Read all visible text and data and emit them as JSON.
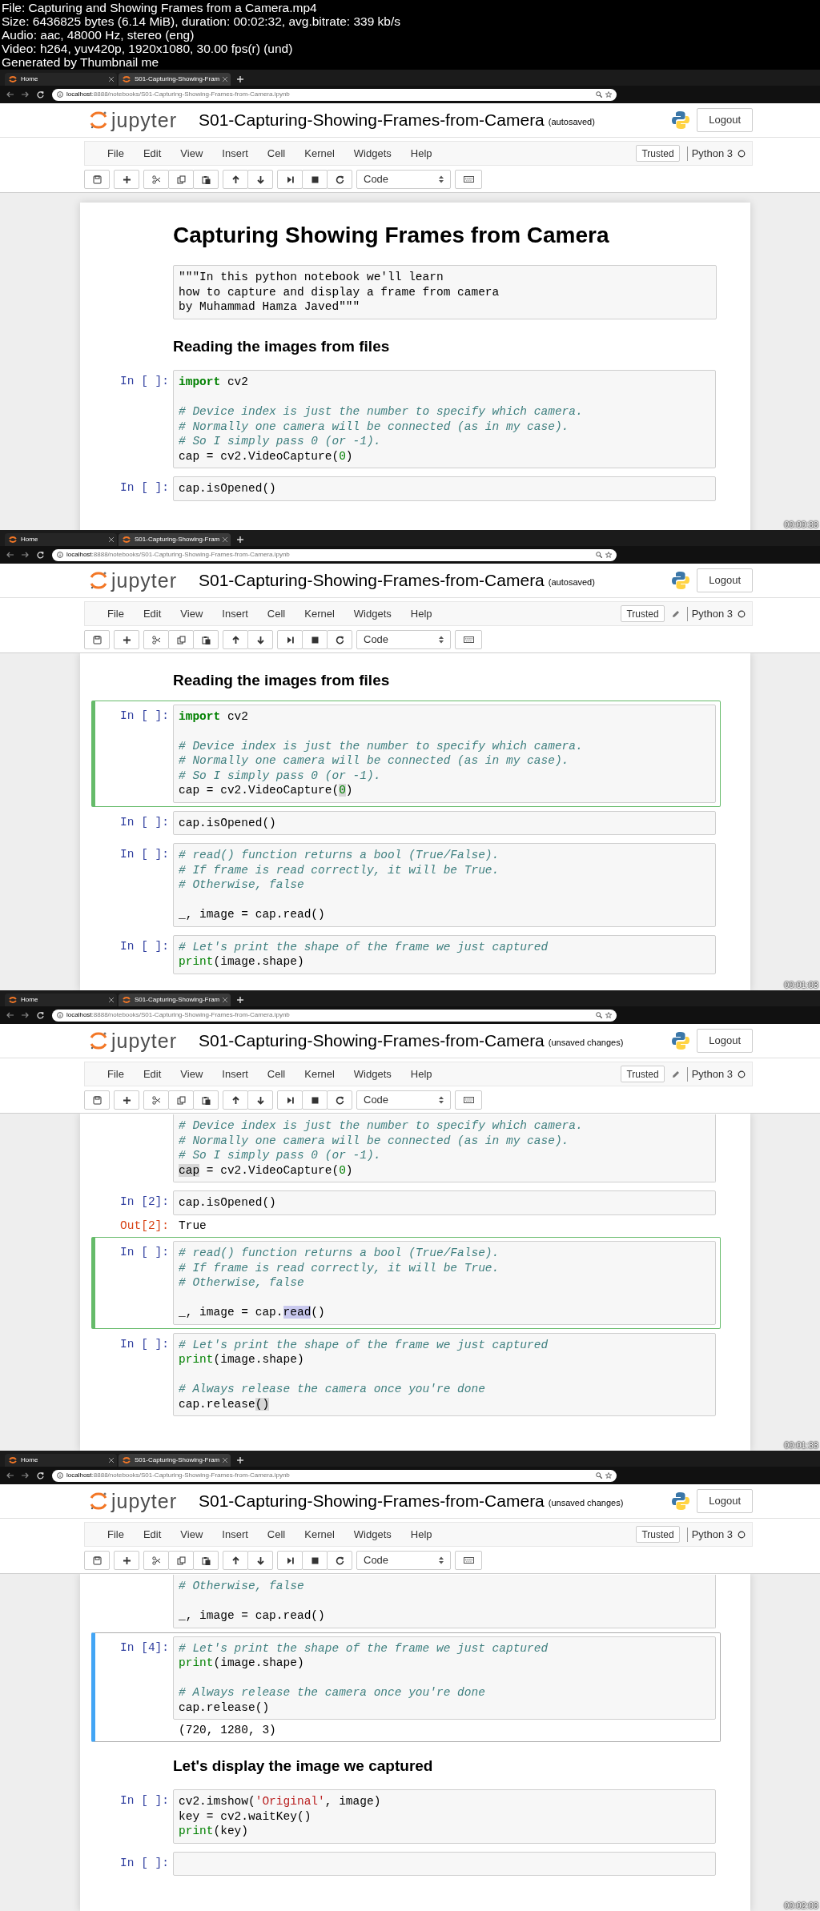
{
  "file_info": [
    "File: Capturing and Showing Frames from a Camera.mp4",
    "Size: 6436825 bytes (6.14 MiB), duration: 00:02:32, avg.bitrate: 339 kb/s",
    "Audio: aac, 48000 Hz, stereo (eng)",
    "Video: h264, yuv420p, 1920x1080, 30.00 fps(r) (und)",
    "Generated by Thumbnail me"
  ],
  "frames": [
    {
      "timestamp": "00:00:33",
      "tabs": [
        {
          "title": "Home",
          "selected": false
        },
        {
          "title": "S01-Capturing-Showing-Fram",
          "selected": true
        }
      ],
      "url_host": "localhost",
      "url_rest": ":8888/notebooks/S01-Capturing-Showing-Frames-from-Camera.ipynb",
      "logo_text": "jupyter",
      "notebook_name": "S01-Capturing-Showing-Frames-from-Camera",
      "save_status": "(autosaved)",
      "logout": "Logout",
      "menu": [
        "File",
        "Edit",
        "View",
        "Insert",
        "Cell",
        "Kernel",
        "Widgets",
        "Help"
      ],
      "trusted": "Trusted",
      "edit_indicator": false,
      "kernel": "Python 3",
      "cell_type": "Code",
      "page_top_visible": true,
      "cells": [
        {
          "kind": "heading1",
          "text": "Capturing Showing Frames from Camera"
        },
        {
          "kind": "raw",
          "lines": [
            "\"\"\"In this python notebook we'll learn",
            "how to capture and display a frame from camera",
            "by Muhammad Hamza Javed\"\"\""
          ]
        },
        {
          "kind": "heading2",
          "text": "Reading the images from files"
        },
        {
          "kind": "code",
          "prompt": "In [ ]:",
          "selected": false,
          "cut_top": false,
          "lines": [
            {
              "kind": "code",
              "tokens": [
                {
                  "kind": "keyword",
                  "text": "import"
                },
                {
                  "kind": "plain",
                  "text": " cv2"
                }
              ]
            },
            {
              "kind": "blank"
            },
            {
              "kind": "code",
              "tokens": [
                {
                  "kind": "comment",
                  "text": "# Device index is just the number to specify which camera."
                }
              ]
            },
            {
              "kind": "code",
              "tokens": [
                {
                  "kind": "comment",
                  "text": "# Normally one camera will be connected (as in my case)."
                }
              ]
            },
            {
              "kind": "code",
              "tokens": [
                {
                  "kind": "comment",
                  "text": "# So I simply pass 0 (or -1)."
                }
              ]
            },
            {
              "kind": "code",
              "tokens": [
                {
                  "kind": "plain",
                  "text": "cap = cv2.VideoCapture("
                },
                {
                  "kind": "number",
                  "text": "0"
                },
                {
                  "kind": "plain",
                  "text": ")"
                }
              ]
            }
          ]
        },
        {
          "kind": "code",
          "prompt": "In [ ]:",
          "selected": false,
          "cut_top": false,
          "lines": [
            {
              "kind": "code",
              "tokens": [
                {
                  "kind": "plain",
                  "text": "cap.isOpened()"
                }
              ]
            }
          ]
        }
      ]
    },
    {
      "timestamp": "00:01:03",
      "tabs": [
        {
          "title": "Home",
          "selected": false
        },
        {
          "title": "S01-Capturing-Showing-Fram",
          "selected": true
        }
      ],
      "url_host": "localhost",
      "url_rest": ":8888/notebooks/S01-Capturing-Showing-Frames-from-Camera.ipynb",
      "logo_text": "jupyter",
      "notebook_name": "S01-Capturing-Showing-Frames-from-Camera",
      "save_status": "(autosaved)",
      "logout": "Logout",
      "menu": [
        "File",
        "Edit",
        "View",
        "Insert",
        "Cell",
        "Kernel",
        "Widgets",
        "Help"
      ],
      "trusted": "Trusted",
      "edit_indicator": true,
      "kernel": "Python 3",
      "cell_type": "Code",
      "page_top_visible": false,
      "cells": [
        {
          "kind": "heading2",
          "text": "Reading the images from files"
        },
        {
          "kind": "code",
          "prompt": "In [ ]:",
          "selected": true,
          "editing": true,
          "cut_top": false,
          "lines": [
            {
              "kind": "code",
              "tokens": [
                {
                  "kind": "keyword",
                  "text": "import"
                },
                {
                  "kind": "plain",
                  "text": " cv2"
                }
              ]
            },
            {
              "kind": "blank"
            },
            {
              "kind": "code",
              "tokens": [
                {
                  "kind": "comment",
                  "text": "# Device index is just the number to specify which camera."
                }
              ]
            },
            {
              "kind": "code",
              "tokens": [
                {
                  "kind": "comment",
                  "text": "# Normally one camera will be connected (as in my case)."
                }
              ]
            },
            {
              "kind": "code",
              "tokens": [
                {
                  "kind": "comment",
                  "text": "# So I simply pass 0 (or -1)."
                }
              ]
            },
            {
              "kind": "code",
              "tokens": [
                {
                  "kind": "plain",
                  "text": "cap = cv2.VideoCapture("
                },
                {
                  "kind": "number_match",
                  "text": "0"
                },
                {
                  "kind": "plain",
                  "text": ")"
                }
              ]
            }
          ]
        },
        {
          "kind": "code",
          "prompt": "In [ ]:",
          "selected": false,
          "cut_top": false,
          "lines": [
            {
              "kind": "code",
              "tokens": [
                {
                  "kind": "plain",
                  "text": "cap.isOpened()"
                }
              ]
            }
          ]
        },
        {
          "kind": "code",
          "prompt": "In [ ]:",
          "selected": false,
          "cut_top": false,
          "lines": [
            {
              "kind": "code",
              "tokens": [
                {
                  "kind": "comment",
                  "text": "# read() function returns a bool (True/False)."
                }
              ]
            },
            {
              "kind": "code",
              "tokens": [
                {
                  "kind": "comment",
                  "text": "# If frame is read correctly, it will be True."
                }
              ]
            },
            {
              "kind": "code",
              "tokens": [
                {
                  "kind": "comment",
                  "text": "# Otherwise, false"
                }
              ]
            },
            {
              "kind": "blank"
            },
            {
              "kind": "code",
              "tokens": [
                {
                  "kind": "plain",
                  "text": "_, image = cap.read()"
                }
              ]
            }
          ]
        },
        {
          "kind": "code",
          "prompt": "In [ ]:",
          "selected": false,
          "cut_top": false,
          "lines": [
            {
              "kind": "code",
              "tokens": [
                {
                  "kind": "comment",
                  "text": "# Let's print the shape of the frame we just captured"
                }
              ]
            },
            {
              "kind": "code",
              "tokens": [
                {
                  "kind": "builtin",
                  "text": "print"
                },
                {
                  "kind": "plain",
                  "text": "(image.shape)"
                }
              ]
            }
          ]
        }
      ]
    },
    {
      "timestamp": "00:01:33",
      "tabs": [
        {
          "title": "Home",
          "selected": false
        },
        {
          "title": "S01-Capturing-Showing-Fram",
          "selected": true
        }
      ],
      "url_host": "localhost",
      "url_rest": ":8888/notebooks/S01-Capturing-Showing-Frames-from-Camera.ipynb",
      "logo_text": "jupyter",
      "notebook_name": "S01-Capturing-Showing-Frames-from-Camera",
      "save_status": "(unsaved changes)",
      "logout": "Logout",
      "menu": [
        "File",
        "Edit",
        "View",
        "Insert",
        "Cell",
        "Kernel",
        "Widgets",
        "Help"
      ],
      "trusted": "Trusted",
      "edit_indicator": true,
      "kernel": "Python 3",
      "cell_type": "Code",
      "page_top_visible": false,
      "cells": [
        {
          "kind": "code",
          "selected": false,
          "cut_top": true,
          "lines": [
            {
              "kind": "code",
              "tokens": [
                {
                  "kind": "comment",
                  "text": "# Device index is just the number to specify which camera."
                }
              ]
            },
            {
              "kind": "code",
              "tokens": [
                {
                  "kind": "comment",
                  "text": "# Normally one camera will be connected (as in my case)."
                }
              ]
            },
            {
              "kind": "code",
              "tokens": [
                {
                  "kind": "comment",
                  "text": "# So I simply pass 0 (or -1)."
                }
              ]
            },
            {
              "kind": "code",
              "tokens": [
                {
                  "kind": "match",
                  "text": "cap"
                },
                {
                  "kind": "plain",
                  "text": " = cv2.VideoCapture("
                },
                {
                  "kind": "number",
                  "text": "0"
                },
                {
                  "kind": "plain",
                  "text": ")"
                }
              ]
            }
          ]
        },
        {
          "kind": "code",
          "prompt": "In [2]:",
          "selected": false,
          "cut_top": false,
          "lines": [
            {
              "kind": "code",
              "tokens": [
                {
                  "kind": "plain",
                  "text": "cap.isOpened()"
                }
              ]
            }
          ],
          "output": {
            "prompt": "Out[2]:",
            "text": "True"
          }
        },
        {
          "kind": "code",
          "prompt": "In [ ]:",
          "selected": true,
          "editing": true,
          "cut_top": false,
          "lines": [
            {
              "kind": "code",
              "tokens": [
                {
                  "kind": "comment",
                  "text": "# read() function returns a bool (True/False)."
                }
              ]
            },
            {
              "kind": "code",
              "tokens": [
                {
                  "kind": "comment",
                  "text": "# If frame is read correctly, it will be True."
                }
              ]
            },
            {
              "kind": "code",
              "tokens": [
                {
                  "kind": "comment",
                  "text": "# Otherwise, false"
                }
              ]
            },
            {
              "kind": "blank"
            },
            {
              "kind": "code",
              "tokens": [
                {
                  "kind": "plain",
                  "text": "_, image = cap."
                },
                {
                  "kind": "selection",
                  "text": "read"
                },
                {
                  "kind": "plain",
                  "text": "()"
                }
              ]
            }
          ]
        },
        {
          "kind": "code",
          "prompt": "In [ ]:",
          "selected": false,
          "cut_top": false,
          "lines": [
            {
              "kind": "code",
              "tokens": [
                {
                  "kind": "comment",
                  "text": "# Let's print the shape of the frame we just captured"
                }
              ]
            },
            {
              "kind": "code",
              "tokens": [
                {
                  "kind": "builtin",
                  "text": "print"
                },
                {
                  "kind": "plain",
                  "text": "(image.shape)"
                }
              ]
            },
            {
              "kind": "blank"
            },
            {
              "kind": "code",
              "tokens": [
                {
                  "kind": "comment",
                  "text": "# Always release the camera once you're done"
                }
              ]
            },
            {
              "kind": "code",
              "tokens": [
                {
                  "kind": "plain",
                  "text": "cap.release"
                },
                {
                  "kind": "match",
                  "text": "()"
                }
              ]
            }
          ]
        }
      ]
    },
    {
      "timestamp": "00:02:03",
      "tabs": [
        {
          "title": "Home",
          "selected": false
        },
        {
          "title": "S01-Capturing-Showing-Fram",
          "selected": true
        }
      ],
      "url_host": "localhost",
      "url_rest": ":8888/notebooks/S01-Capturing-Showing-Frames-from-Camera.ipynb",
      "logo_text": "jupyter",
      "notebook_name": "S01-Capturing-Showing-Frames-from-Camera",
      "save_status": "(unsaved changes)",
      "logout": "Logout",
      "menu": [
        "File",
        "Edit",
        "View",
        "Insert",
        "Cell",
        "Kernel",
        "Widgets",
        "Help"
      ],
      "trusted": "Trusted",
      "edit_indicator": false,
      "kernel": "Python 3",
      "cell_type": "Code",
      "page_top_visible": false,
      "cells": [
        {
          "kind": "code",
          "selected": false,
          "cut_top": true,
          "lines": [
            {
              "kind": "code",
              "tokens": [
                {
                  "kind": "comment",
                  "text": "# Otherwise, false"
                }
              ]
            },
            {
              "kind": "blank"
            },
            {
              "kind": "code",
              "tokens": [
                {
                  "kind": "plain",
                  "text": "_, image = cap.read()"
                }
              ]
            }
          ]
        },
        {
          "kind": "code",
          "prompt": "In [4]:",
          "selected": true,
          "editing": false,
          "cut_top": false,
          "lines": [
            {
              "kind": "code",
              "tokens": [
                {
                  "kind": "comment",
                  "text": "# Let's print the shape of the frame we just captured"
                }
              ]
            },
            {
              "kind": "code",
              "tokens": [
                {
                  "kind": "builtin",
                  "text": "print"
                },
                {
                  "kind": "plain",
                  "text": "(image.shape)"
                }
              ]
            },
            {
              "kind": "blank"
            },
            {
              "kind": "code",
              "tokens": [
                {
                  "kind": "comment",
                  "text": "# Always release the camera once you're done"
                }
              ]
            },
            {
              "kind": "code",
              "tokens": [
                {
                  "kind": "plain",
                  "text": "cap.release()"
                }
              ]
            }
          ],
          "output": {
            "text": "(720, 1280, 3)"
          }
        },
        {
          "kind": "heading2",
          "text": "Let's display the image we captured"
        },
        {
          "kind": "code",
          "prompt": "In [ ]:",
          "selected": false,
          "cut_top": false,
          "lines": [
            {
              "kind": "code",
              "tokens": [
                {
                  "kind": "plain",
                  "text": "cv2.imshow("
                },
                {
                  "kind": "string",
                  "text": "'Original'"
                },
                {
                  "kind": "plain",
                  "text": ", image)"
                }
              ]
            },
            {
              "kind": "code",
              "tokens": [
                {
                  "kind": "plain",
                  "text": "key = cv2.waitKey()"
                }
              ]
            },
            {
              "kind": "code",
              "tokens": [
                {
                  "kind": "builtin",
                  "text": "print"
                },
                {
                  "kind": "plain",
                  "text": "(key)"
                }
              ]
            }
          ]
        },
        {
          "kind": "code",
          "prompt": "In [ ]:",
          "selected": false,
          "cut_top": false
        }
      ]
    }
  ]
}
